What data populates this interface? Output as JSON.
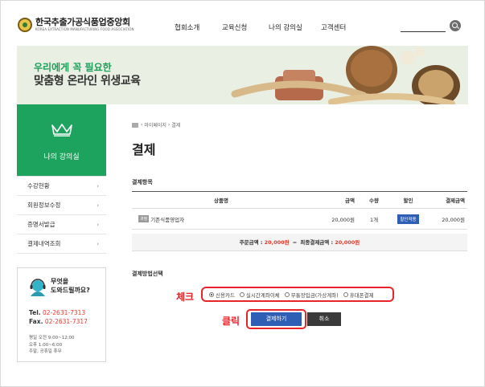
{
  "header": {
    "logo_ko": "한국추출가공식품업중앙회",
    "logo_en": "KOREA EXTRACTION MANUFACTURING FOOD ASSOCIATION",
    "nav": [
      "협회소개",
      "교육신청",
      "나의 강의실",
      "고객센터"
    ]
  },
  "banner": {
    "sub": "우리에게 꼭 필요한",
    "main": "맞춤형 온라인 위생교육"
  },
  "sidebar": {
    "title": "나의 강의실",
    "items": [
      {
        "label": "수강현황",
        "chev": "›"
      },
      {
        "label": "회원정보수정",
        "chev": "›"
      },
      {
        "label": "증명서발급",
        "chev": "›"
      },
      {
        "label": "결제내역조회",
        "chev": "›"
      }
    ],
    "help": {
      "q1": "무엇을",
      "q2": "도와드릴까요?",
      "tel_label": "Tel.",
      "tel": "02-2631-7313",
      "fax_label": "Fax.",
      "fax": "02-2631-7317",
      "hours1": "평일 오전 9:00~12:00",
      "hours2": "오후 1:00~6:00",
      "hours3": "주말, 공휴일 휴무"
    }
  },
  "main": {
    "breadcrumb": [
      "마이페이지",
      "결제"
    ],
    "breadcrumb_sep": "›",
    "title": "결제",
    "items_label": "결제항목",
    "columns": [
      "상품명",
      "금액",
      "수량",
      "할인",
      "결제금액"
    ],
    "row": {
      "badge": "과정",
      "name": "기존식품영업자",
      "price": "20,000원",
      "qty": "1개",
      "discount_btn": "할인적용",
      "total": "20,000원"
    },
    "summary": {
      "order_label": "주문금액 :",
      "order_amount": "20,000원",
      "eq": "=",
      "final_label": "최종결제금액 :",
      "final_amount": "20,000원"
    },
    "method_label": "결제방법선택",
    "methods": [
      "신용카드",
      "실시간계좌이체",
      "무통장입금(가상계좌)",
      "휴대폰결제"
    ],
    "selected_method": "신용카드",
    "check_annotation": "체크",
    "click_annotation": "클릭",
    "pay_button": "결제하기",
    "cancel_button": "취소"
  }
}
